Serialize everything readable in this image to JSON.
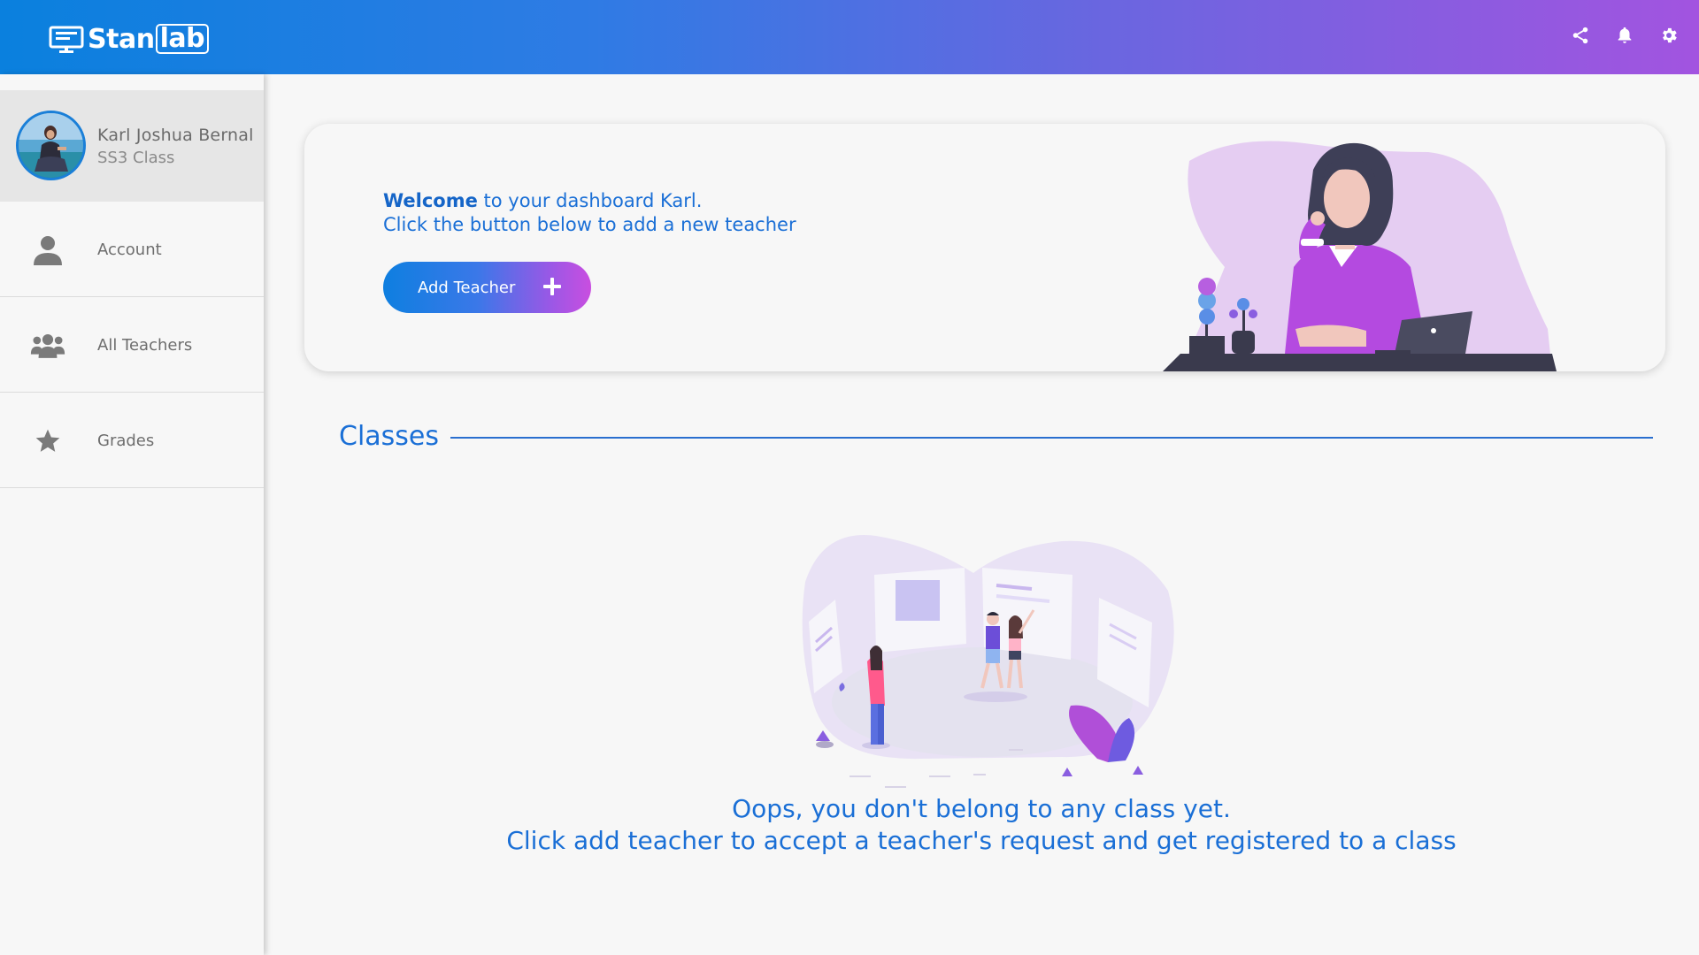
{
  "app": {
    "logo_text_main": "Stan",
    "logo_text_box": "lab"
  },
  "topbar": {
    "icons": [
      "share-icon",
      "bell-icon",
      "gear-icon"
    ]
  },
  "profile": {
    "name": "Karl Joshua Bernal",
    "class": "SS3 Class"
  },
  "sidebar": {
    "items": [
      {
        "label": "Account",
        "icon": "user-icon"
      },
      {
        "label": "All Teachers",
        "icon": "users-group-icon"
      },
      {
        "label": "Grades",
        "icon": "star-icon"
      }
    ]
  },
  "welcome": {
    "strong": "Welcome",
    "rest": " to your dashboard Karl.",
    "line2": "Click the button below to add a new teacher",
    "button_label": "Add Teacher"
  },
  "classes": {
    "title": "Classes",
    "empty_line1": "Oops, you don't belong to any class yet.",
    "empty_line2": "Click add teacher to accept a teacher's request and get registered to a class"
  },
  "colors": {
    "accent": "#1a6fd6",
    "gradient_start": "#0a80de",
    "gradient_end": "#a254e0"
  }
}
